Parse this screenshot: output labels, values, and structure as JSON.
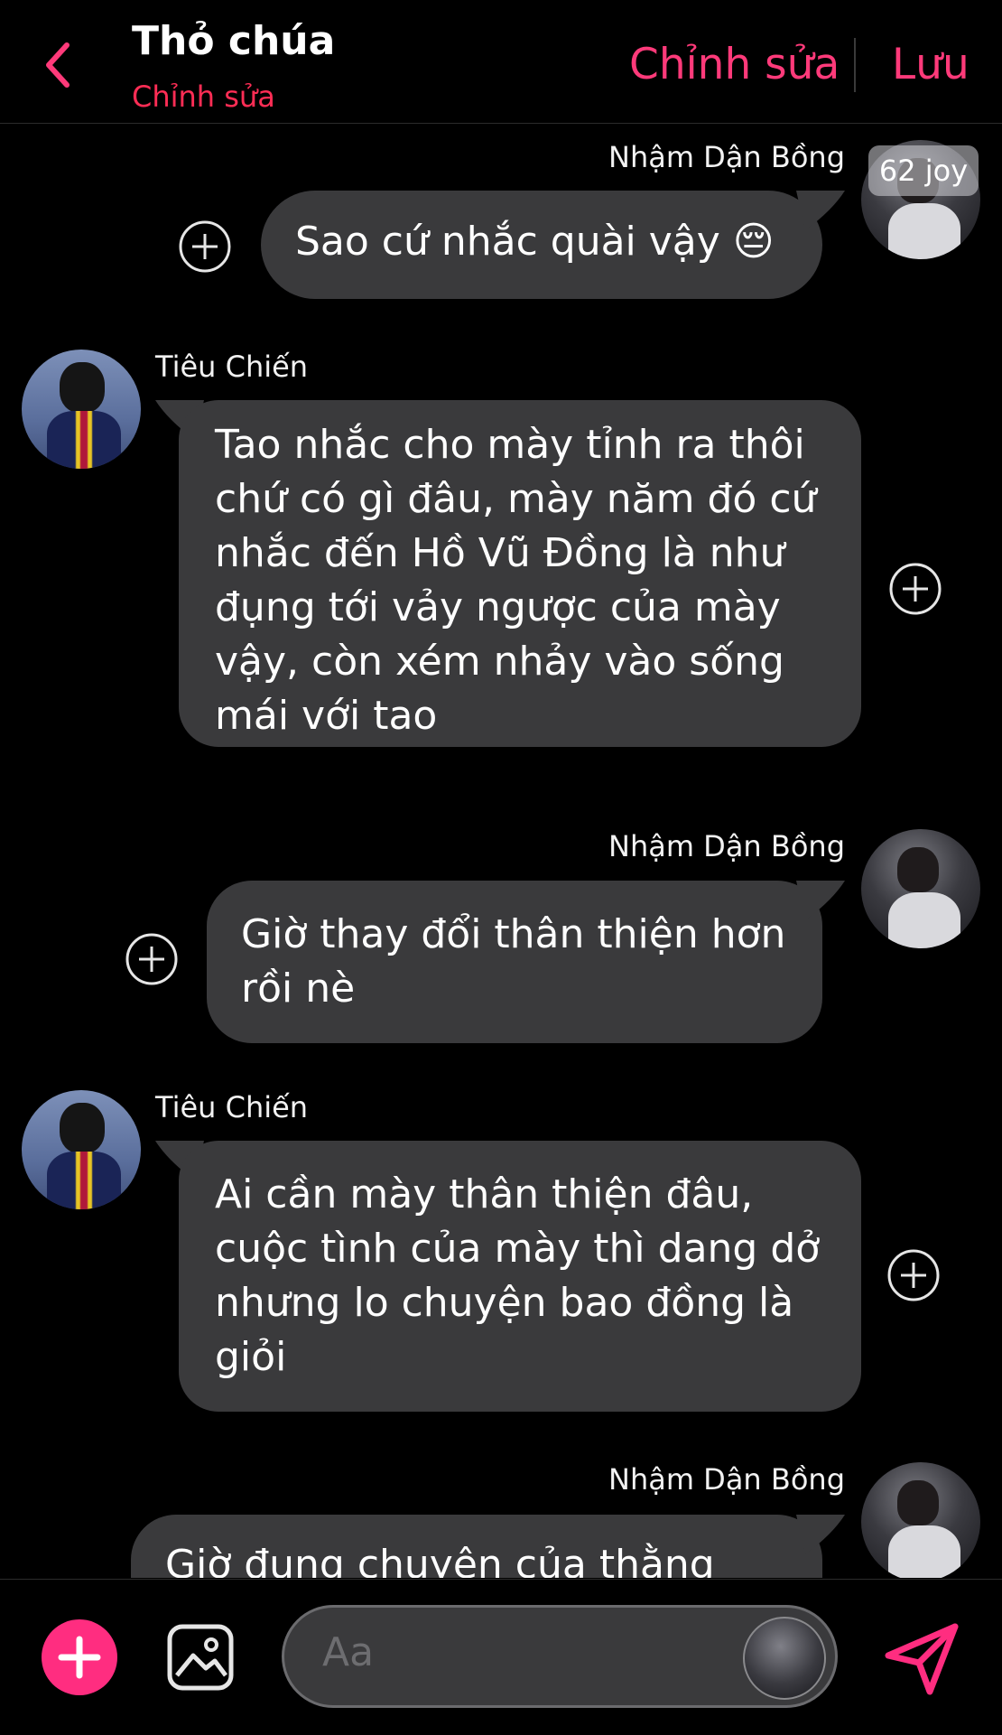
{
  "header": {
    "title": "Thỏ chúa",
    "subtitle": "Chỉnh sửa",
    "edit_label": "Chỉnh sửa",
    "save_label": "Lưu",
    "accent": "#ff3a7a"
  },
  "watermark": "62 joy",
  "messages": [
    {
      "sender": "Nhậm Dận Bồng",
      "side": "right",
      "text": "Sao cứ nhắc quài vậy 😔"
    },
    {
      "sender": "Tiêu Chiến",
      "side": "left",
      "text": "Tao nhắc cho mày tỉnh ra thôi\nchứ có gì đâu, mày năm đó cứ\nnhắc đến Hồ Vũ Đồng là như\nđụng tới vảy ngược của mày\nvậy, còn xém nhảy vào sống\nmái với tao"
    },
    {
      "sender": "Nhậm Dận Bồng",
      "side": "right",
      "text": "Giờ thay đổi thân thiện hơn\nrồi nè"
    },
    {
      "sender": "Tiêu Chiến",
      "side": "left",
      "text": "Ai cần mày thân thiện đâu,\ncuộc tình của mày thì dang dở\nnhưng lo chuyện bao đồng là\ngiỏi"
    },
    {
      "sender": "Nhậm Dận Bồng",
      "side": "right",
      "text": "Giờ đụng chuyện của thằng"
    }
  ],
  "composer": {
    "placeholder": "Aa",
    "icons": [
      "plus-icon",
      "image-icon",
      "send-icon"
    ]
  },
  "colors": {
    "background": "#000000",
    "bubble": "#3a3a3c",
    "accent": "#ff2d80"
  }
}
